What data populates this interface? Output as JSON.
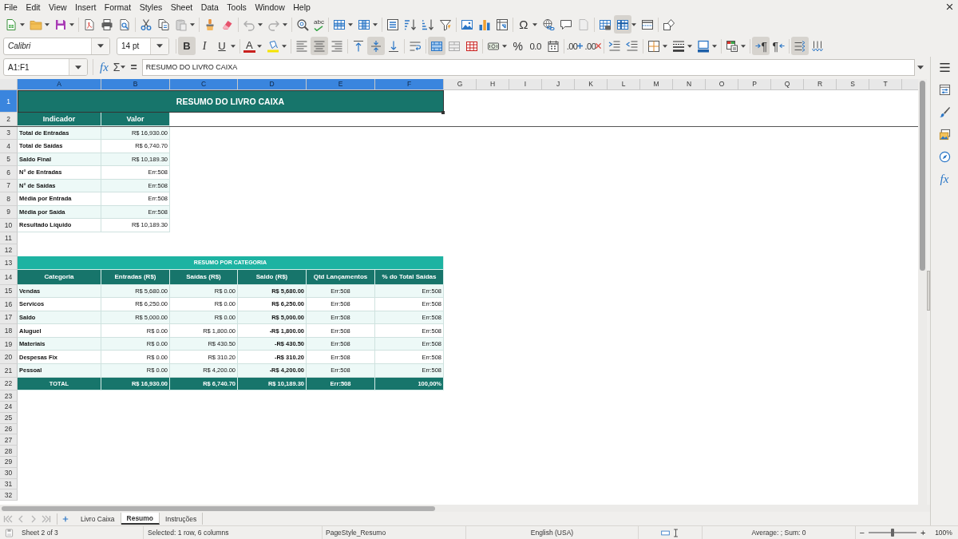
{
  "menu_bar": [
    "File",
    "Edit",
    "View",
    "Insert",
    "Format",
    "Styles",
    "Sheet",
    "Data",
    "Tools",
    "Window",
    "Help"
  ],
  "standard_toolbar": {
    "spelling_label": "abc",
    "special_character_label": "Ω",
    "freeze_rows_and_columns_on": true
  },
  "formatting_toolbar": {
    "font_name": "Calibri",
    "font_size": "14 pt",
    "bold": {
      "label": "B",
      "on": true
    },
    "italic": {
      "label": "I",
      "on": false
    },
    "underline": {
      "label": "U",
      "on": false
    },
    "font_color_label": "A",
    "horizontal_align": [
      {
        "kind": "left",
        "selected": false
      },
      {
        "kind": "center",
        "selected": true
      },
      {
        "kind": "right",
        "selected": false
      }
    ],
    "vertical_align": [
      {
        "kind": "top",
        "selected": false
      },
      {
        "kind": "center",
        "selected": true
      },
      {
        "kind": "bottom",
        "selected": false
      }
    ],
    "merge_and_center_on": true,
    "percent_label": "%",
    "number_format_label": "0.0",
    "add_decimal_label": ".00",
    "delete_decimal_label": ".00",
    "paragraph_direction": [
      {
        "kind": "ltr",
        "label": "¶",
        "selected": true
      },
      {
        "kind": "rtl",
        "label": "¶",
        "selected": false
      }
    ],
    "text_orientation": [
      {
        "kind": "horizontal",
        "selected": true
      },
      {
        "kind": "vertical",
        "selected": false
      }
    ]
  },
  "formula_bar": {
    "name_box": "A1:F1",
    "function_wizard_label": "fx",
    "sum_label": "Σ",
    "formula_label": "=",
    "content": "RESUMO DO LIVRO CAIXA"
  },
  "sidebar": {
    "functions_label": "fx"
  },
  "sheet": {
    "column_headers": [
      {
        "label": "A",
        "selected": true
      },
      {
        "label": "B",
        "selected": true
      },
      {
        "label": "C",
        "selected": true
      },
      {
        "label": "D",
        "selected": true
      },
      {
        "label": "E",
        "selected": true
      },
      {
        "label": "F",
        "selected": true
      },
      {
        "label": "G",
        "selected": false
      },
      {
        "label": "H",
        "selected": false
      },
      {
        "label": "I",
        "selected": false
      },
      {
        "label": "J",
        "selected": false
      },
      {
        "label": "K",
        "selected": false
      },
      {
        "label": "L",
        "selected": false
      },
      {
        "label": "M",
        "selected": false
      },
      {
        "label": "N",
        "selected": false
      },
      {
        "label": "O",
        "selected": false
      },
      {
        "label": "P",
        "selected": false
      },
      {
        "label": "Q",
        "selected": false
      },
      {
        "label": "R",
        "selected": false
      },
      {
        "label": "S",
        "selected": false
      },
      {
        "label": "T",
        "selected": false
      }
    ],
    "row_headers": [
      {
        "label": "1",
        "selected": true
      },
      {
        "label": "2",
        "selected": false
      },
      {
        "label": "3",
        "selected": false
      },
      {
        "label": "4",
        "selected": false
      },
      {
        "label": "5",
        "selected": false
      },
      {
        "label": "6",
        "selected": false
      },
      {
        "label": "7",
        "selected": false
      },
      {
        "label": "8",
        "selected": false
      },
      {
        "label": "9",
        "selected": false
      },
      {
        "label": "10",
        "selected": false
      },
      {
        "label": "11",
        "selected": false
      },
      {
        "label": "12",
        "selected": false
      },
      {
        "label": "13",
        "selected": false
      },
      {
        "label": "14",
        "selected": false
      },
      {
        "label": "15",
        "selected": false
      },
      {
        "label": "16",
        "selected": false
      },
      {
        "label": "17",
        "selected": false
      },
      {
        "label": "18",
        "selected": false
      },
      {
        "label": "19",
        "selected": false
      },
      {
        "label": "20",
        "selected": false
      },
      {
        "label": "21",
        "selected": false
      },
      {
        "label": "22",
        "selected": false
      },
      {
        "label": "23",
        "selected": false
      },
      {
        "label": "24",
        "selected": false
      },
      {
        "label": "25",
        "selected": false
      },
      {
        "label": "26",
        "selected": false
      },
      {
        "label": "27",
        "selected": false
      },
      {
        "label": "28",
        "selected": false
      },
      {
        "label": "29",
        "selected": false
      },
      {
        "label": "30",
        "selected": false
      },
      {
        "label": "31",
        "selected": false
      },
      {
        "label": "32",
        "selected": false
      }
    ],
    "summary_table": {
      "title": "RESUMO DO LIVRO CAIXA",
      "title_selected": true,
      "columns": [
        "Indicador",
        "Valor"
      ],
      "rows": [
        [
          "Total de Entradas",
          "R$ 16,930.00"
        ],
        [
          "Total de Saídas",
          "R$ 6,740.70"
        ],
        [
          "Saldo Final",
          "R$ 10,189.30"
        ],
        [
          "N° de Entradas",
          "Err:508"
        ],
        [
          "N° de Saídas",
          "Err:508"
        ],
        [
          "Média por Entrada",
          "Err:508"
        ],
        [
          "Média por Saída",
          "Err:508"
        ],
        [
          "Resultado Líquido",
          "R$ 10,189.30"
        ]
      ]
    },
    "category_table": {
      "title": "RESUMO POR CATEGORIA",
      "columns": [
        "Categoria",
        "Entradas (R$)",
        "Saídas (R$)",
        "Saldo (R$)",
        "Qtd Lançamentos",
        "% do Total Saídas"
      ],
      "rows": [
        [
          "Vendas",
          "R$ 5,680.00",
          "R$ 0.00",
          "R$ 5,680.00",
          "Err:508",
          "Err:508"
        ],
        [
          "Servicos",
          "R$ 6,250.00",
          "R$ 0.00",
          "R$ 6,250.00",
          "Err:508",
          "Err:508"
        ],
        [
          "Saldo",
          "R$ 5,000.00",
          "R$ 0.00",
          "R$ 5,000.00",
          "Err:508",
          "Err:508"
        ],
        [
          "Aluguel",
          "R$ 0.00",
          "R$ 1,800.00",
          "-R$ 1,800.00",
          "Err:508",
          "Err:508"
        ],
        [
          "Materiais",
          "R$ 0.00",
          "R$ 430.50",
          "-R$ 430.50",
          "Err:508",
          "Err:508"
        ],
        [
          "Despesas Fix",
          "R$ 0.00",
          "R$ 310.20",
          "-R$ 310.20",
          "Err:508",
          "Err:508"
        ],
        [
          "Pessoal",
          "R$ 0.00",
          "R$ 4,200.00",
          "-R$ 4,200.00",
          "Err:508",
          "Err:508"
        ]
      ],
      "total_row": [
        "TOTAL",
        "R$ 16,930.00",
        "R$ 6,740.70",
        "R$ 10,189.30",
        "Err:508",
        "100,00%"
      ]
    }
  },
  "sheet_tabs": [
    {
      "label": "Livro Caixa",
      "selected": false
    },
    {
      "label": "Resumo",
      "selected": true
    },
    {
      "label": "Instruções",
      "selected": false
    }
  ],
  "status_bar": {
    "sheet_position": "Sheet 2 of 3",
    "selection": "Selected: 1 row, 6 columns",
    "page_style": "PageStyle_Resumo",
    "language": "English (USA)",
    "statistics": "Average: ; Sum: 0",
    "zoom_out": "−",
    "zoom_slider": {
      "level": 0.5
    },
    "zoom_in": "+",
    "zoom": "100%"
  }
}
